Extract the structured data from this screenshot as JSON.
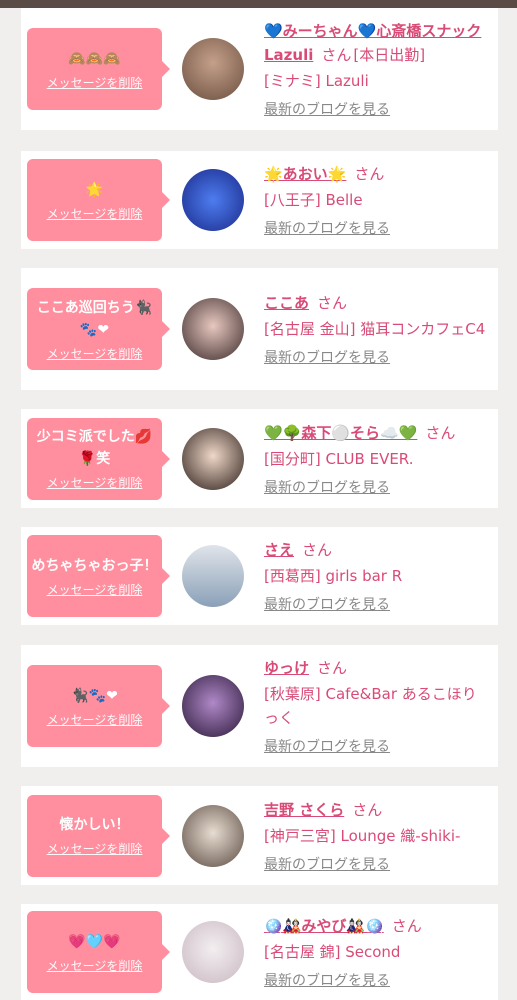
{
  "colors": {
    "accent": "#ff8f9f",
    "name": "#d94b77",
    "link_grey": "#888888"
  },
  "cards": [
    {
      "message": "🙈🙈🙈",
      "delete_label": "メッセージを削除",
      "name": "💙みーちゃん💙心斎橋スナックLazuli",
      "san": "さん",
      "tag": "[本日出勤]",
      "shop": "[ミナミ] Lazuli",
      "blog_label": "最新のブログを見る",
      "avatar_colors": [
        "#6b4f3f",
        "#c4a08a"
      ]
    },
    {
      "message": "🌟",
      "delete_label": "メッセージを削除",
      "name": "🌟あおい🌟",
      "san": "さん",
      "tag": "",
      "shop": "[八王子] Belle",
      "blog_label": "最新のブログを見る",
      "avatar_colors": [
        "#1a2a8a",
        "#4e7df0"
      ]
    },
    {
      "message": "ここあ巡回ちう🐈‍⬛🐾❤",
      "delete_label": "メッセージを削除",
      "name": "ここあ",
      "san": "さん",
      "tag": "",
      "shop": "[名古屋 金山] 猫耳コンカフェC4",
      "blog_label": "最新のブログを見る",
      "avatar_colors": [
        "#3a2a2a",
        "#e8c8c0"
      ]
    },
    {
      "message": "少コミ派でした💋🌹笑",
      "delete_label": "メッセージを削除",
      "name": "💚🌳森下⚪️そら☁️💚",
      "san": "さん",
      "tag": "",
      "shop": "[国分町] CLUB EVER.",
      "blog_label": "最新のブログを見る",
      "avatar_colors": [
        "#2b1e1a",
        "#f0d8c8"
      ]
    },
    {
      "message": "めちゃちゃおっ子！",
      "delete_label": "メッセージを削除",
      "name": "さえ",
      "san": "さん",
      "tag": "",
      "shop": "[西葛西] girls bar R",
      "blog_label": "最新のブログを見る",
      "avatar_colors": [
        "#8aa0b8",
        "#e0e4ea"
      ]
    },
    {
      "message": "🐈‍⬛🐾❤",
      "delete_label": "メッセージを削除",
      "name": "ゆっけ",
      "san": "さん",
      "tag": "",
      "shop": "[秋葉原] Cafe&Bar あるこほりっく",
      "blog_label": "最新のブログを見る",
      "avatar_colors": [
        "#2a1838",
        "#b089c8"
      ]
    },
    {
      "message": "懐かしい！",
      "delete_label": "メッセージを削除",
      "name": "吉野 さくら",
      "san": "さん",
      "tag": "",
      "shop": "[神戸三宮] Lounge 織-shiki-",
      "blog_label": "最新のブログを見る",
      "avatar_colors": [
        "#5a4a40",
        "#e8ddd2"
      ]
    },
    {
      "message": "💗🩵💗",
      "delete_label": "メッセージを削除",
      "name": "🪩🎎みやび🎎🪩",
      "san": "さん",
      "tag": "",
      "shop": "[名古屋 錦] Second",
      "blog_label": "最新のブログを見る",
      "avatar_colors": [
        "#c9b8c2",
        "#f3eef0"
      ]
    }
  ]
}
